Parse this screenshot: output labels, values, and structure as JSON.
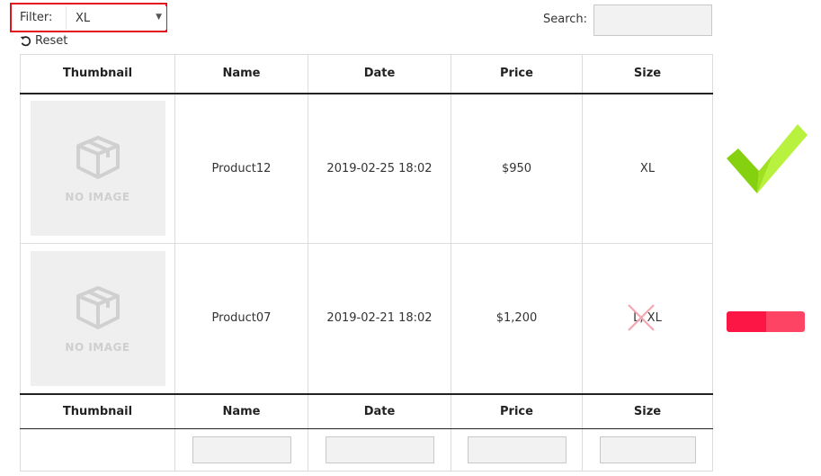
{
  "filter": {
    "label": "Filter:",
    "value": "XL"
  },
  "reset": {
    "label": "Reset"
  },
  "search": {
    "label": "Search:",
    "value": ""
  },
  "table": {
    "headers": [
      "Thumbnail",
      "Name",
      "Date",
      "Price",
      "Size"
    ],
    "rows": [
      {
        "thumbnail": "NO IMAGE",
        "name": "Product12",
        "date": "2019-02-25 18:02",
        "price": "$950",
        "size": "XL"
      },
      {
        "thumbnail": "NO IMAGE",
        "name": "Product07",
        "date": "2019-02-21 18:02",
        "price": "$1,200",
        "size": "L, XL"
      }
    ],
    "footer_headers": [
      "Thumbnail",
      "Name",
      "Date",
      "Price",
      "Size"
    ]
  },
  "markers": {
    "row1": "checkmark-icon",
    "row2": "red-bar-icon"
  },
  "colors": {
    "filter_border": "#e3121b",
    "check_dark": "#86d10f",
    "check_light": "#b9f23e",
    "bar_dark": "#fc1645",
    "bar_light": "#fe4465",
    "cross_x": "#f4a7b2"
  }
}
